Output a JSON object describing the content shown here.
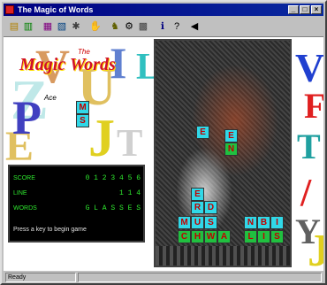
{
  "window": {
    "title": "The Magic of Words"
  },
  "game": {
    "logo_text": "Magic Words",
    "logo_small": "The",
    "tagline": "Ace"
  },
  "falling_word": [
    "M",
    "S"
  ],
  "tile_stack": [
    {
      "text": "E",
      "color": "cyan"
    },
    {
      "text": "R",
      "color": "cyan"
    },
    {
      "text": "D",
      "color": "cyan"
    },
    {
      "text": "N",
      "color": "cyan"
    }
  ],
  "board_tiles_row1": [
    "E",
    "N"
  ],
  "board_tiles_row2": [
    "E",
    "R",
    "D"
  ],
  "board_tiles_row3": [
    "M",
    "U",
    "S",
    "N",
    "B",
    "I"
  ],
  "board_tiles_row4": [
    "C",
    "H",
    "W",
    "A",
    "L",
    "I",
    "S"
  ],
  "score_panel": {
    "rows": [
      {
        "label": "SCORE",
        "value": "0 1 2 3 4 5 6"
      },
      {
        "label": "LINE",
        "value": "1 1 4"
      },
      {
        "label": "WORDS",
        "value": "G L A S S E S"
      }
    ],
    "message": "Press a key to begin game"
  },
  "status": {
    "left": "Ready",
    "right": ""
  }
}
